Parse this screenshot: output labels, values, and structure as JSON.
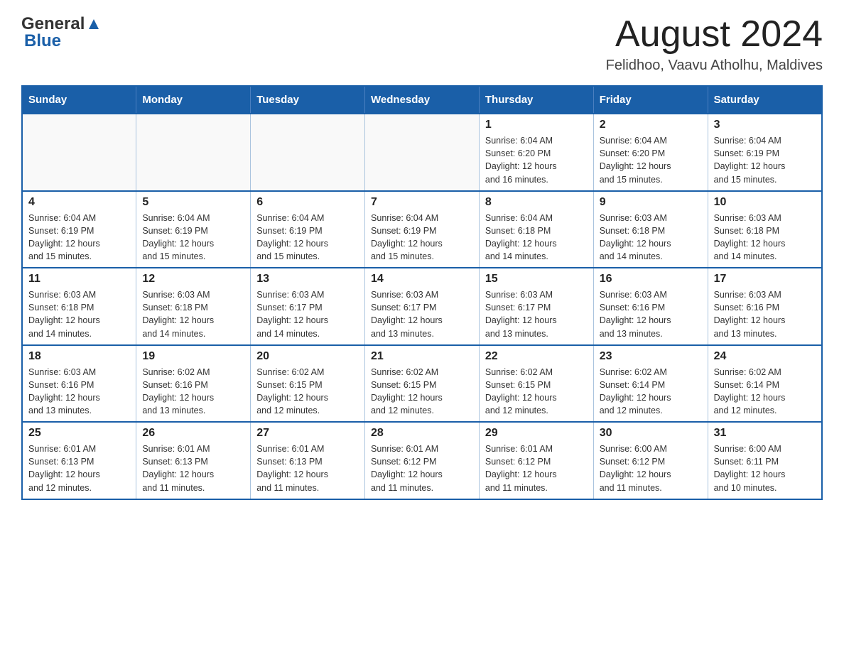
{
  "header": {
    "logo_general": "General",
    "logo_blue": "Blue",
    "month_title": "August 2024",
    "location": "Felidhoo, Vaavu Atholhu, Maldives"
  },
  "calendar": {
    "days_of_week": [
      "Sunday",
      "Monday",
      "Tuesday",
      "Wednesday",
      "Thursday",
      "Friday",
      "Saturday"
    ],
    "weeks": [
      [
        {
          "day": "",
          "info": ""
        },
        {
          "day": "",
          "info": ""
        },
        {
          "day": "",
          "info": ""
        },
        {
          "day": "",
          "info": ""
        },
        {
          "day": "1",
          "info": "Sunrise: 6:04 AM\nSunset: 6:20 PM\nDaylight: 12 hours\nand 16 minutes."
        },
        {
          "day": "2",
          "info": "Sunrise: 6:04 AM\nSunset: 6:20 PM\nDaylight: 12 hours\nand 15 minutes."
        },
        {
          "day": "3",
          "info": "Sunrise: 6:04 AM\nSunset: 6:19 PM\nDaylight: 12 hours\nand 15 minutes."
        }
      ],
      [
        {
          "day": "4",
          "info": "Sunrise: 6:04 AM\nSunset: 6:19 PM\nDaylight: 12 hours\nand 15 minutes."
        },
        {
          "day": "5",
          "info": "Sunrise: 6:04 AM\nSunset: 6:19 PM\nDaylight: 12 hours\nand 15 minutes."
        },
        {
          "day": "6",
          "info": "Sunrise: 6:04 AM\nSunset: 6:19 PM\nDaylight: 12 hours\nand 15 minutes."
        },
        {
          "day": "7",
          "info": "Sunrise: 6:04 AM\nSunset: 6:19 PM\nDaylight: 12 hours\nand 15 minutes."
        },
        {
          "day": "8",
          "info": "Sunrise: 6:04 AM\nSunset: 6:18 PM\nDaylight: 12 hours\nand 14 minutes."
        },
        {
          "day": "9",
          "info": "Sunrise: 6:03 AM\nSunset: 6:18 PM\nDaylight: 12 hours\nand 14 minutes."
        },
        {
          "day": "10",
          "info": "Sunrise: 6:03 AM\nSunset: 6:18 PM\nDaylight: 12 hours\nand 14 minutes."
        }
      ],
      [
        {
          "day": "11",
          "info": "Sunrise: 6:03 AM\nSunset: 6:18 PM\nDaylight: 12 hours\nand 14 minutes."
        },
        {
          "day": "12",
          "info": "Sunrise: 6:03 AM\nSunset: 6:18 PM\nDaylight: 12 hours\nand 14 minutes."
        },
        {
          "day": "13",
          "info": "Sunrise: 6:03 AM\nSunset: 6:17 PM\nDaylight: 12 hours\nand 14 minutes."
        },
        {
          "day": "14",
          "info": "Sunrise: 6:03 AM\nSunset: 6:17 PM\nDaylight: 12 hours\nand 13 minutes."
        },
        {
          "day": "15",
          "info": "Sunrise: 6:03 AM\nSunset: 6:17 PM\nDaylight: 12 hours\nand 13 minutes."
        },
        {
          "day": "16",
          "info": "Sunrise: 6:03 AM\nSunset: 6:16 PM\nDaylight: 12 hours\nand 13 minutes."
        },
        {
          "day": "17",
          "info": "Sunrise: 6:03 AM\nSunset: 6:16 PM\nDaylight: 12 hours\nand 13 minutes."
        }
      ],
      [
        {
          "day": "18",
          "info": "Sunrise: 6:03 AM\nSunset: 6:16 PM\nDaylight: 12 hours\nand 13 minutes."
        },
        {
          "day": "19",
          "info": "Sunrise: 6:02 AM\nSunset: 6:16 PM\nDaylight: 12 hours\nand 13 minutes."
        },
        {
          "day": "20",
          "info": "Sunrise: 6:02 AM\nSunset: 6:15 PM\nDaylight: 12 hours\nand 12 minutes."
        },
        {
          "day": "21",
          "info": "Sunrise: 6:02 AM\nSunset: 6:15 PM\nDaylight: 12 hours\nand 12 minutes."
        },
        {
          "day": "22",
          "info": "Sunrise: 6:02 AM\nSunset: 6:15 PM\nDaylight: 12 hours\nand 12 minutes."
        },
        {
          "day": "23",
          "info": "Sunrise: 6:02 AM\nSunset: 6:14 PM\nDaylight: 12 hours\nand 12 minutes."
        },
        {
          "day": "24",
          "info": "Sunrise: 6:02 AM\nSunset: 6:14 PM\nDaylight: 12 hours\nand 12 minutes."
        }
      ],
      [
        {
          "day": "25",
          "info": "Sunrise: 6:01 AM\nSunset: 6:13 PM\nDaylight: 12 hours\nand 12 minutes."
        },
        {
          "day": "26",
          "info": "Sunrise: 6:01 AM\nSunset: 6:13 PM\nDaylight: 12 hours\nand 11 minutes."
        },
        {
          "day": "27",
          "info": "Sunrise: 6:01 AM\nSunset: 6:13 PM\nDaylight: 12 hours\nand 11 minutes."
        },
        {
          "day": "28",
          "info": "Sunrise: 6:01 AM\nSunset: 6:12 PM\nDaylight: 12 hours\nand 11 minutes."
        },
        {
          "day": "29",
          "info": "Sunrise: 6:01 AM\nSunset: 6:12 PM\nDaylight: 12 hours\nand 11 minutes."
        },
        {
          "day": "30",
          "info": "Sunrise: 6:00 AM\nSunset: 6:12 PM\nDaylight: 12 hours\nand 11 minutes."
        },
        {
          "day": "31",
          "info": "Sunrise: 6:00 AM\nSunset: 6:11 PM\nDaylight: 12 hours\nand 10 minutes."
        }
      ]
    ]
  }
}
